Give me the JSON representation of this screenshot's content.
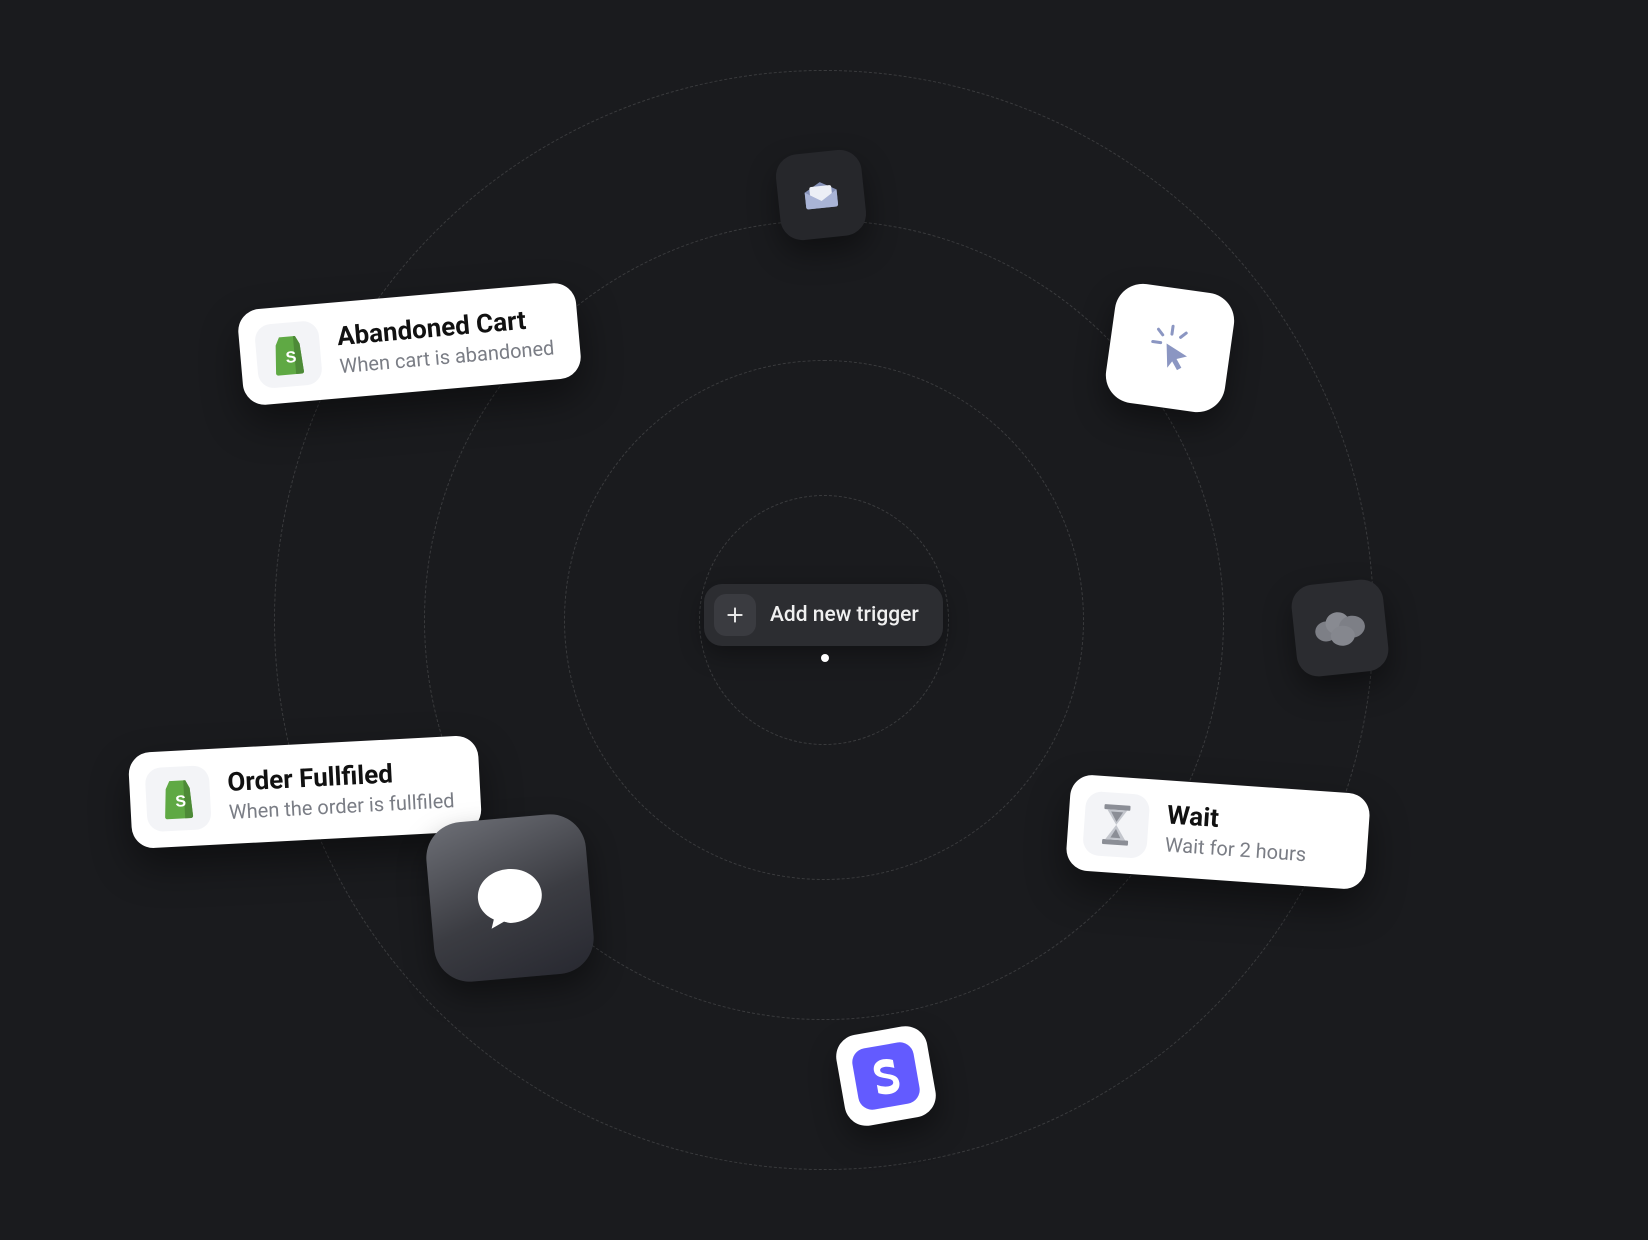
{
  "center": {
    "add_trigger_label": "Add new trigger"
  },
  "cards": {
    "abandoned": {
      "title": "Abandoned Cart",
      "subtitle": "When cart is abandoned",
      "icon": "shopify-bag-icon"
    },
    "order": {
      "title": "Order Fullfiled",
      "subtitle": "When the order is fullfiled",
      "icon": "shopify-bag-icon"
    },
    "wait": {
      "title": "Wait",
      "subtitle": "Wait for 2 hours",
      "icon": "hourglass-icon"
    }
  },
  "tiles": {
    "inbox": "inbox-icon",
    "click": "cursor-click-icon",
    "cloud": "salesforce-cloud-icon",
    "message": "chat-bubble-icon",
    "stripe": "stripe-s-icon"
  },
  "colors": {
    "background": "#1a1b1e",
    "card_bg": "#ffffff",
    "tile_dark": "#2b2c30",
    "stripe_purple": "#635bff",
    "shopify_green": "#5fa944"
  }
}
